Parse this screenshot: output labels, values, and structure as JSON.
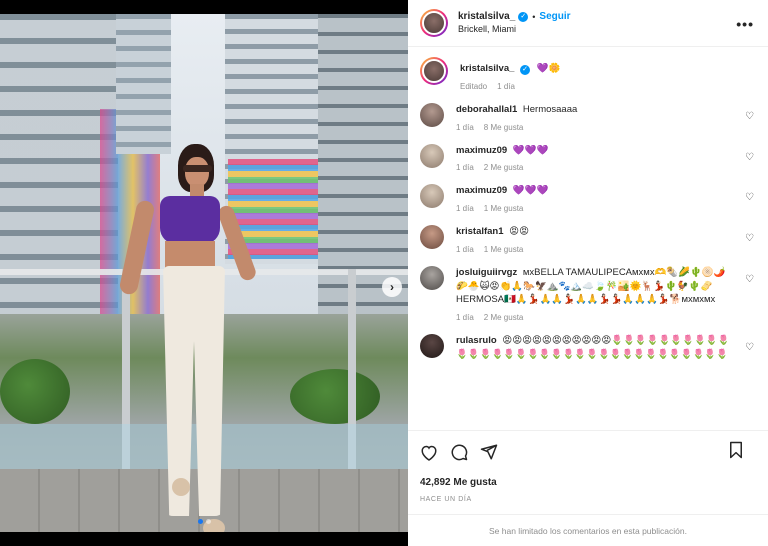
{
  "post": {
    "username": "kristalsilva_",
    "follow_label": "Seguir",
    "separator": "•",
    "location": "Brickell, Miami",
    "more_label": "•••",
    "next_label": "›"
  },
  "caption": {
    "username": "kristalsilva_",
    "text": "💜🌼",
    "edited": "Editado",
    "time": "1 día"
  },
  "comments": [
    {
      "username": "deborahallal1",
      "text": "Hermosaaaa",
      "time": "1 día",
      "likes": "8 Me gusta"
    },
    {
      "username": "maximuz09",
      "text": "💜💜💜",
      "time": "1 día",
      "likes": "2 Me gusta"
    },
    {
      "username": "maximuz09",
      "text": "💜💜💜",
      "time": "1 día",
      "likes": "1 Me gusta"
    },
    {
      "username": "kristalfan1",
      "text": "😡😡",
      "time": "1 día",
      "likes": "1 Me gusta"
    },
    {
      "username": "josluiguiirvgz",
      "text": "ᴍxBELLA TAMAULIPECAᴍxᴍx🫶🌯🌽🌵🫓🌶️🌮🐣🙀😡👏🙏🐎🦅⛰️🐾🏔️☁️🍃🎋🏜️🌞🦌💃🏻🌵🐓🌵🫔HERMOSA🇲🇽🙏💃🏻🙏🙏💃🏻🙏🙏💃🏻💃🏻🙏🙏🙏💃🏻🐕ᴍxᴍxᴍx",
      "time": "1 día",
      "likes": "2 Me gusta"
    },
    {
      "username": "rulasrulo",
      "text": "😡😡😡😡😡😡😡😡😡😡😡🌷🌷🌷🌷🌷🌷🌷🌷🌷🌷🌷🌷🌷🌷🌷🌷🌷🌷🌷🌷🌷🌷🌷🌷🌷🌷🌷🌷🌷🌷🌷🌷🌷",
      "time": "",
      "likes": ""
    }
  ],
  "likes_count": "42,892 Me gusta",
  "posted": "HACE UN DÍA",
  "comments_limited": "Se han limitado los comentarios en esta publicación.",
  "icons": {
    "verified": "verified-badge-icon",
    "heart": "heart-icon",
    "comment": "comment-icon",
    "share": "share-icon",
    "bookmark": "bookmark-icon",
    "more": "more-options-icon",
    "next": "chevron-right-icon"
  },
  "colors": {
    "accent": "#0095f6",
    "text": "#262626",
    "muted": "#8e8e8e",
    "carousel_active": "#1877f2"
  }
}
